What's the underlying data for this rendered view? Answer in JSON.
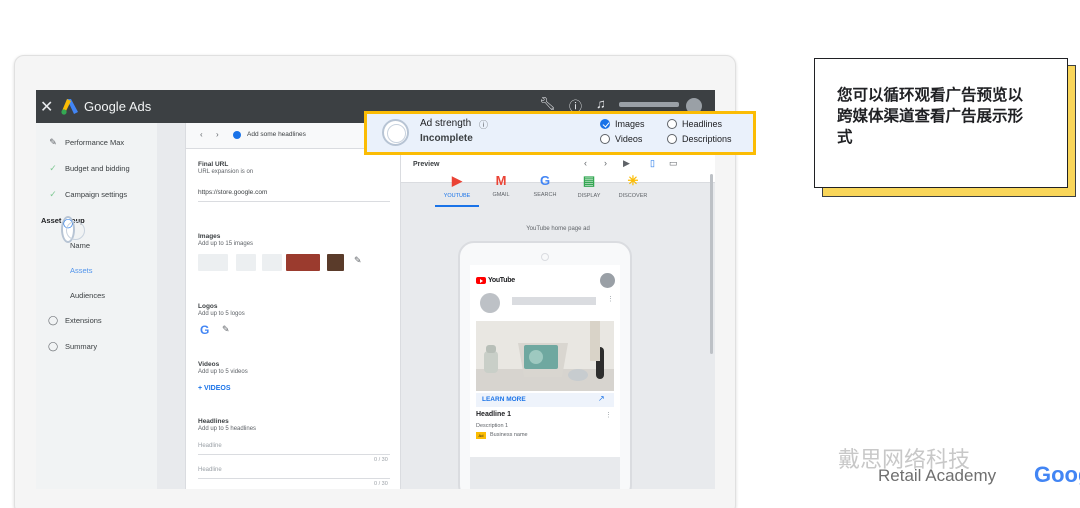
{
  "app": {
    "close_icon": "close-icon",
    "brand": "Google Ads"
  },
  "nav": {
    "items": [
      {
        "label": "Performance Max",
        "icon": "pencil-icon"
      },
      {
        "label": "Budget and bidding",
        "icon": "check-icon"
      },
      {
        "label": "Campaign settings",
        "icon": "check-icon"
      },
      {
        "label": "Asset group",
        "icon": "ring-icon"
      },
      {
        "label": "Name"
      },
      {
        "label": "Assets"
      },
      {
        "label": "Audiences"
      },
      {
        "label": "Extensions",
        "icon": "ring-icon"
      },
      {
        "label": "Summary",
        "icon": "ring-icon"
      }
    ]
  },
  "editor": {
    "header_title": "Add some headlines",
    "final_url_label": "Final URL",
    "final_url_hint": "URL expansion is on",
    "final_url_value": "https://store.google.com",
    "images_label": "Images",
    "images_hint": "Add up to 15 images",
    "logos_label": "Logos",
    "logos_hint": "Add up to 5 logos",
    "videos_label": "Videos",
    "videos_hint": "Add up to 5 videos",
    "videos_button": "+ VIDEOS",
    "headlines_label": "Headlines",
    "headlines_hint": "Add up to 5 headlines",
    "headline_placeholder_1": "Headline",
    "headline_count_1": "0 / 30",
    "headline_placeholder_2": "Headline",
    "headline_count_2": "0 / 30"
  },
  "ad_strength": {
    "label": "Ad strength",
    "status": "Incomplete",
    "checks": [
      {
        "label": "Images",
        "checked": true
      },
      {
        "label": "Headlines",
        "checked": false
      },
      {
        "label": "Videos",
        "checked": false
      },
      {
        "label": "Descriptions",
        "checked": false
      }
    ]
  },
  "preview": {
    "title": "Preview",
    "channels": [
      {
        "label": "YOUTUBE",
        "glyph": "▶",
        "color": "#ea4335"
      },
      {
        "label": "GMAIL",
        "glyph": "M",
        "color": "#ea4335"
      },
      {
        "label": "SEARCH",
        "glyph": "G",
        "color": "#4285f4"
      },
      {
        "label": "DISPLAY",
        "glyph": "▤",
        "color": "#34a853"
      },
      {
        "label": "DISCOVER",
        "glyph": "✳",
        "color": "#fbbc04"
      }
    ],
    "subtitle": "YouTube home page ad",
    "ad": {
      "yt_brand": "YouTube",
      "cta": "LEARN MORE",
      "headline": "Headline 1",
      "description": "Description 1",
      "ad_badge": "Ad",
      "business": "Business name"
    }
  },
  "note": {
    "text": "您可以循环观看广告预览以跨媒体渠道查看广告展示形式"
  },
  "watermark": {
    "text": "戴思网络科技",
    "sub": "Retail Academy",
    "brand": "Goog"
  }
}
